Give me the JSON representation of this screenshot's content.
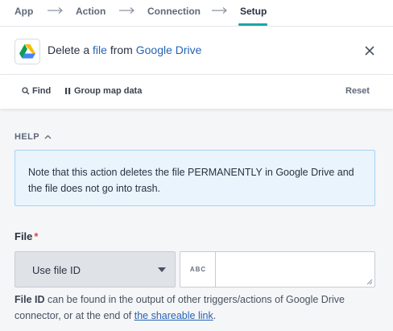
{
  "stepper": {
    "steps": [
      {
        "label": "App"
      },
      {
        "label": "Action"
      },
      {
        "label": "Connection"
      },
      {
        "label": "Setup"
      }
    ],
    "active_step": "Setup",
    "accent_color": "#1aa7a6"
  },
  "header": {
    "prefix": "Delete a ",
    "object_link": "file",
    "middle": " from ",
    "app_link": "Google Drive",
    "logo_icon": "google-drive-icon",
    "close_icon": "close-icon"
  },
  "toolbar": {
    "find_label": "Find",
    "group_label": "Group map data",
    "reset_label": "Reset"
  },
  "help": {
    "toggle_label": "HELP",
    "text": "Note that this action deletes the file PERMANENTLY in Google Drive and the file does not go into trash."
  },
  "file_field": {
    "label": "File",
    "required_mark": "*",
    "select_value": "Use file ID",
    "type_badge": "ABC",
    "input_value": "",
    "hint_bold": "File ID",
    "hint_text": " can be found in the output of other triggers/actions of Google Drive connector, or at the end of ",
    "hint_link": "the shareable link",
    "hint_end": "."
  },
  "colors": {
    "link": "#2663b4",
    "help_bg": "#e9f4fc",
    "help_border": "#a8d3f1",
    "required": "#d9453d"
  }
}
